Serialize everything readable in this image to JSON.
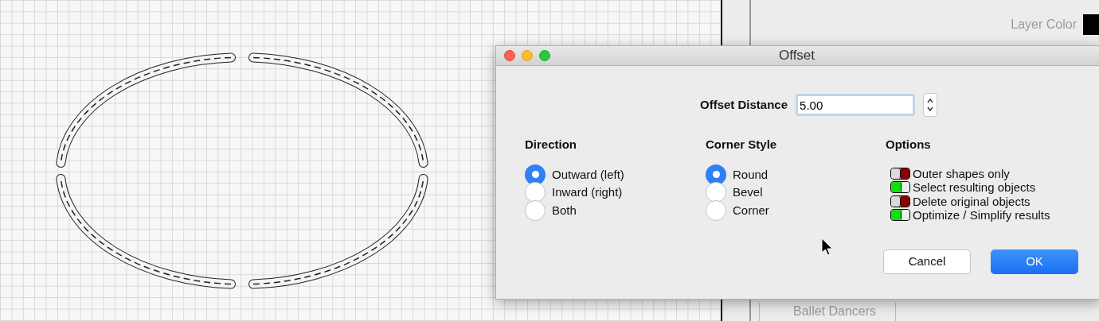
{
  "side_panel": {
    "layer_color": {
      "label": "Layer Color",
      "color": "#000000"
    },
    "list_items": [
      "Ballet Dancers"
    ]
  },
  "dialog": {
    "title": "Offset",
    "offset_distance": {
      "label": "Offset Distance",
      "value": "5.00"
    },
    "direction": {
      "title": "Direction",
      "options": [
        {
          "label": "Outward (left)",
          "selected": true
        },
        {
          "label": "Inward (right)",
          "selected": false
        },
        {
          "label": "Both",
          "selected": false
        }
      ]
    },
    "corner_style": {
      "title": "Corner Style",
      "options": [
        {
          "label": "Round",
          "selected": true
        },
        {
          "label": "Bevel",
          "selected": false
        },
        {
          "label": "Corner",
          "selected": false
        }
      ]
    },
    "options": {
      "title": "Options",
      "items": [
        {
          "label": "Outer shapes only",
          "checked": false
        },
        {
          "label": "Select resulting objects",
          "checked": true
        },
        {
          "label": "Delete original objects",
          "checked": false
        },
        {
          "label": "Optimize / Simplify results",
          "checked": true
        }
      ]
    },
    "buttons": [
      {
        "label": "Cancel",
        "kind": "cancel"
      },
      {
        "label": "OK",
        "kind": "default"
      }
    ]
  }
}
